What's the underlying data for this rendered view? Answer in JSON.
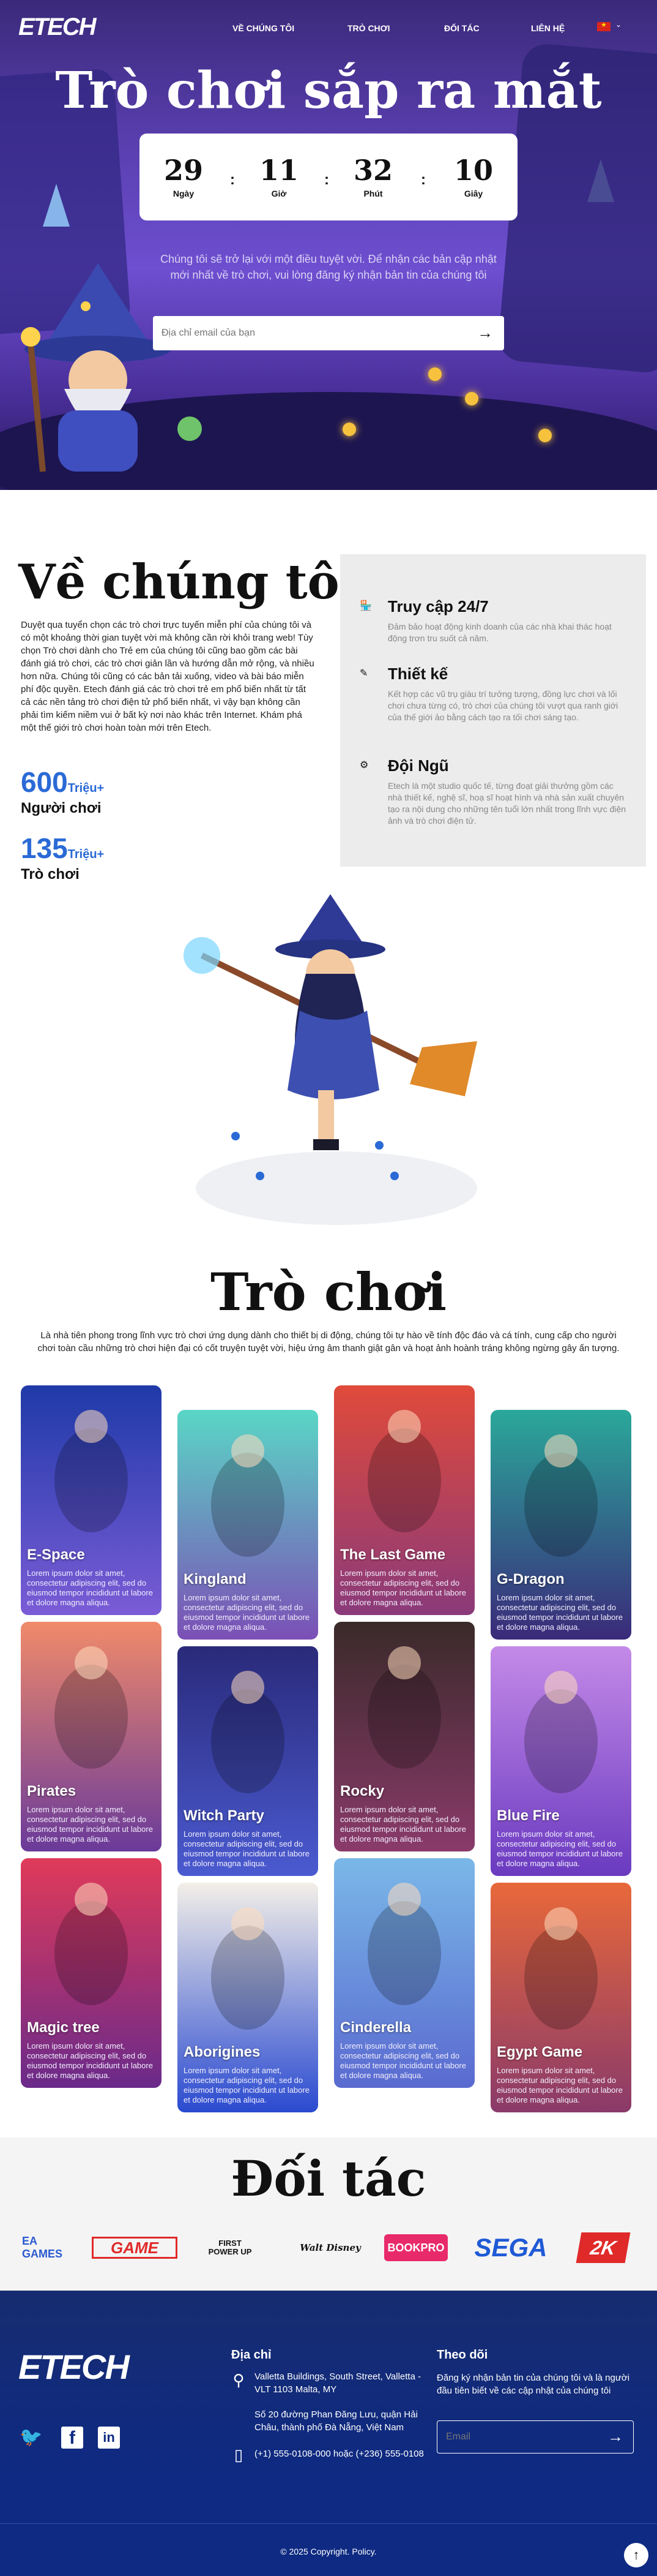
{
  "brand": {
    "logo": "ETECH"
  },
  "nav": {
    "items": [
      "VỀ CHÚNG TÔI",
      "TRÒ CHƠI",
      "ĐỐI TÁC",
      "LIÊN HỆ"
    ]
  },
  "hero": {
    "title": "Trò chơi sắp ra mắt",
    "countdown": [
      {
        "value": "29",
        "label": "Ngày"
      },
      {
        "value": "11",
        "label": "Giờ"
      },
      {
        "value": "32",
        "label": "Phút"
      },
      {
        "value": "10",
        "label": "Giây"
      }
    ],
    "description": "Chúng tôi sẽ trở lại với một điều tuyệt vời. Để nhận các bản cập nhật mới nhất về trò chơi, vui lòng đăng ký nhận bản tin của chúng tôi",
    "email_placeholder": "Địa chỉ email của bạn"
  },
  "about": {
    "title": "Về chúng tôi",
    "text": "Duyệt qua tuyển chọn các trò chơi trực tuyến miễn phí của chúng tôi và có một khoảng thời gian tuyệt vời mà không cần rời khỏi trang web! Tùy chọn Trò chơi dành cho Trẻ em của chúng tôi cũng bao gồm các bài đánh giá trò chơi, các trò chơi giản lần và hướng dẫn mở rộng, và nhiều hơn nữa. Chúng tôi cũng có các bản tải xuống, video và bài báo miễn phí độc quyền. Etech đánh giá các trò chơi trẻ em phổ biến nhất từ tất cả các nền tảng trò chơi điện tử phổ biến nhất, vì vậy bạn không cần phải tìm kiếm niềm vui ở bất kỳ nơi nào khác trên Internet. Khám phá một thế giới trò chơi hoàn toàn mới trên Etech.",
    "stats": [
      {
        "num": "600",
        "unit": "Triệu+",
        "label": "Người chơi"
      },
      {
        "num": "135",
        "unit": "Triệu+",
        "label": "Trò chơi"
      }
    ],
    "features": [
      {
        "icon": "store-icon",
        "title": "Truy cập 24/7",
        "text": "Đảm bảo hoạt động kinh doanh của các nhà khai thác hoạt động trơn tru suốt cả năm."
      },
      {
        "icon": "design-icon",
        "title": "Thiết kế",
        "text": "Kết hợp các vũ trụ giàu trí tưởng tượng, đồng lực chơi và lối chơi chưa từng có, trò chơi của chúng tôi vượt qua ranh giới của thế giới ảo bằng cách tạo ra tối chơi sáng tạo."
      },
      {
        "icon": "team-icon",
        "title": "Đội Ngũ",
        "text": "Etech là một studio quốc tế, từng đoạt giải thưởng gồm các nhà thiết kế, nghệ sĩ, hoạ sĩ hoạt hình và nhà sản xuất chuyên tạo ra nội dung cho những tên tuổi lớn nhất trong lĩnh vực điện ảnh và trò chơi điện tử."
      }
    ]
  },
  "games": {
    "title": "Trò chơi",
    "description": "Là nhà tiên phong trong lĩnh vực trò chơi ứng dụng dành cho thiết bị di động, chúng tôi tự hào về tính độc đáo và cá tính, cung cấp cho người chơi toàn cầu những trò chơi hiện đại có cốt truyện tuyệt vời, hiệu ứng âm thanh giật gân và hoạt ảnh hoành tráng không ngừng gây ấn tượng.",
    "card_text": "Lorem ipsum dolor sit amet, consectetur adipiscing elit, sed do eiusmod tempor incididunt ut labore et dolore magna aliqua.",
    "items": [
      {
        "name": "E-Space",
        "c1": "#1f3aa8",
        "c2": "#7a5cd6"
      },
      {
        "name": "Kingland",
        "c1": "#5ad6c6",
        "c2": "#7b4fb6"
      },
      {
        "name": "The Last Game",
        "c1": "#e04a3a",
        "c2": "#8a3a7a"
      },
      {
        "name": "G-Dragon",
        "c1": "#2aa89a",
        "c2": "#3a2a7a"
      },
      {
        "name": "Pirates",
        "c1": "#f08a6a",
        "c2": "#6a3a9a"
      },
      {
        "name": "Witch Party",
        "c1": "#2a2a7a",
        "c2": "#4a5ad0"
      },
      {
        "name": "Rocky",
        "c1": "#3a2a2a",
        "c2": "#8a3a6a"
      },
      {
        "name": "Blue Fire",
        "c1": "#c48ae8",
        "c2": "#6a3ac0"
      },
      {
        "name": "Magic tree",
        "c1": "#e03a5a",
        "c2": "#6a2a8a"
      },
      {
        "name": "Aborigines",
        "c1": "#f3efe8",
        "c2": "#2a4ad0"
      },
      {
        "name": "Cinderella",
        "c1": "#7ab8e8",
        "c2": "#5a6ad0"
      },
      {
        "name": "Egypt Game",
        "c1": "#e8683a",
        "c2": "#8a3a6a"
      }
    ]
  },
  "partners": {
    "title": "Đối tác",
    "logos": [
      "EA GAMES",
      "GAME",
      "FIRST POWER UP",
      "Walt Disney",
      "BOOKPRO",
      "SEGA",
      "2K"
    ]
  },
  "footer": {
    "address_title": "Địa chỉ",
    "address1": "Valletta Buildings, South Street, Valletta - VLT 1103 Malta, MY",
    "address2": "Số 20 đường Phan Đăng Lưu, quận Hải Châu, thành phố Đà Nẵng, Việt Nam",
    "phone": "(+1) 555-0108-000 hoặc (+236) 555-0108",
    "follow_title": "Theo dõi",
    "follow_text": "Đăng ký nhận bản tin của chúng tôi và là người đầu tiên biết về các cập nhật của chúng tôi",
    "email_placeholder": "Email",
    "copyright": "© 2025 Copyright. Policy."
  },
  "colors": {
    "accent": "#2a6ad6",
    "footer": "#0e2a82",
    "hero": "#5a3fb0"
  }
}
